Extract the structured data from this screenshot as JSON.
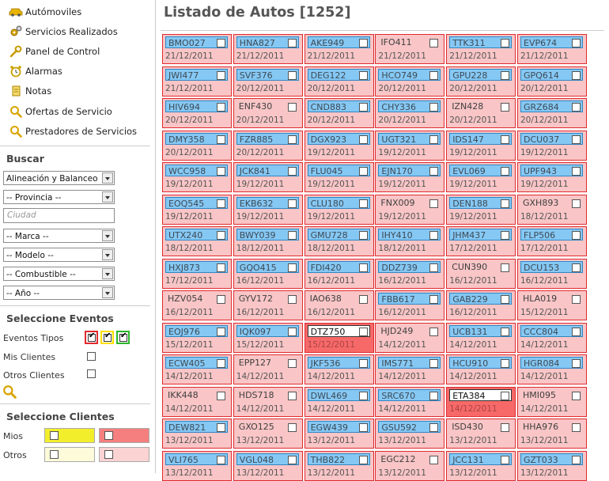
{
  "nav": [
    {
      "label": "Autómoviles",
      "icon": "car-icon"
    },
    {
      "label": "Servicios Realizados",
      "icon": "gears-icon"
    },
    {
      "label": "Panel de Control",
      "icon": "wrench-icon"
    },
    {
      "label": "Alarmas",
      "icon": "alarm-clock-icon"
    },
    {
      "label": "Notas",
      "icon": "note-icon"
    },
    {
      "label": "Ofertas de Servicio",
      "icon": "search-icon"
    },
    {
      "label": "Prestadores de Servicios",
      "icon": "search-icon"
    }
  ],
  "search": {
    "title": "Buscar",
    "servicio": "Alineación y Balanceo",
    "provincia": "-- Provincia --",
    "ciudad_placeholder": "Ciudad",
    "marca": "-- Marca --",
    "modelo": "-- Modelo --",
    "combustible": "-- Combustible --",
    "anio": "-- Año --"
  },
  "events": {
    "title": "Seleccione Eventos",
    "tipos_label": "Eventos Tipos",
    "mis_clientes_label": "Mis Clientes",
    "otros_clientes_label": "Otros Clientes"
  },
  "clients": {
    "title": "Seleccione Clientes",
    "mios_label": "Mios",
    "otros_label": "Otros"
  },
  "colors": {
    "tile_bg": "#f9c5c6",
    "tile_border": "#e02a2e",
    "code_blue": "#86c8f4",
    "highlight": "#f76969",
    "client_yellow": "#f2ee2c",
    "client_red": "#f57f7f"
  },
  "main": {
    "title": "Listado de Autos [1252]"
  },
  "tiles": [
    {
      "code": "BMO027",
      "date": "21/12/2011",
      "style": "blue"
    },
    {
      "code": "HNA827",
      "date": "21/12/2011",
      "style": "blue"
    },
    {
      "code": "AKE949",
      "date": "21/12/2011",
      "style": "blue"
    },
    {
      "code": "IFO411",
      "date": "21/12/2011",
      "style": "plain"
    },
    {
      "code": "TTK311",
      "date": "21/12/2011",
      "style": "blue"
    },
    {
      "code": "EVP674",
      "date": "21/12/2011",
      "style": "blue"
    },
    {
      "code": "JWI477",
      "date": "21/12/2011",
      "style": "blue"
    },
    {
      "code": "SVF376",
      "date": "20/12/2011",
      "style": "blue"
    },
    {
      "code": "DEG122",
      "date": "20/12/2011",
      "style": "blue"
    },
    {
      "code": "HCO749",
      "date": "20/12/2011",
      "style": "blue"
    },
    {
      "code": "GPU228",
      "date": "20/12/2011",
      "style": "blue"
    },
    {
      "code": "GPQ614",
      "date": "20/12/2011",
      "style": "blue"
    },
    {
      "code": "HIV694",
      "date": "20/12/2011",
      "style": "blue"
    },
    {
      "code": "ENF430",
      "date": "20/12/2011",
      "style": "plain"
    },
    {
      "code": "CND883",
      "date": "20/12/2011",
      "style": "blue"
    },
    {
      "code": "CHY336",
      "date": "20/12/2011",
      "style": "blue"
    },
    {
      "code": "IZN428",
      "date": "20/12/2011",
      "style": "plain"
    },
    {
      "code": "GRZ684",
      "date": "20/12/2011",
      "style": "blue"
    },
    {
      "code": "DMY358",
      "date": "20/12/2011",
      "style": "blue"
    },
    {
      "code": "FZR885",
      "date": "20/12/2011",
      "style": "blue"
    },
    {
      "code": "DGX923",
      "date": "19/12/2011",
      "style": "blue"
    },
    {
      "code": "UGT321",
      "date": "19/12/2011",
      "style": "blue"
    },
    {
      "code": "IDS147",
      "date": "19/12/2011",
      "style": "blue"
    },
    {
      "code": "DCU037",
      "date": "19/12/2011",
      "style": "blue"
    },
    {
      "code": "WCC958",
      "date": "19/12/2011",
      "style": "blue"
    },
    {
      "code": "JCK841",
      "date": "19/12/2011",
      "style": "blue"
    },
    {
      "code": "FLU045",
      "date": "19/12/2011",
      "style": "blue"
    },
    {
      "code": "EJN170",
      "date": "19/12/2011",
      "style": "blue"
    },
    {
      "code": "EVL069",
      "date": "19/12/2011",
      "style": "blue"
    },
    {
      "code": "UPF943",
      "date": "19/12/2011",
      "style": "blue"
    },
    {
      "code": "EOQ545",
      "date": "19/12/2011",
      "style": "blue"
    },
    {
      "code": "EKB632",
      "date": "19/12/2011",
      "style": "blue"
    },
    {
      "code": "CLU180",
      "date": "19/12/2011",
      "style": "blue"
    },
    {
      "code": "FNX009",
      "date": "19/12/2011",
      "style": "plain"
    },
    {
      "code": "DEN188",
      "date": "19/12/2011",
      "style": "blue"
    },
    {
      "code": "GXH893",
      "date": "18/12/2011",
      "style": "plain"
    },
    {
      "code": "UTX240",
      "date": "18/12/2011",
      "style": "blue"
    },
    {
      "code": "BWY039",
      "date": "18/12/2011",
      "style": "blue"
    },
    {
      "code": "GMU728",
      "date": "18/12/2011",
      "style": "blue"
    },
    {
      "code": "IHY410",
      "date": "18/12/2011",
      "style": "blue"
    },
    {
      "code": "JHM437",
      "date": "17/12/2011",
      "style": "blue"
    },
    {
      "code": "FLP506",
      "date": "17/12/2011",
      "style": "blue"
    },
    {
      "code": "HXJ873",
      "date": "17/12/2011",
      "style": "blue"
    },
    {
      "code": "GQO415",
      "date": "16/12/2011",
      "style": "blue"
    },
    {
      "code": "FDI420",
      "date": "16/12/2011",
      "style": "blue"
    },
    {
      "code": "DDZ739",
      "date": "16/12/2011",
      "style": "blue"
    },
    {
      "code": "CUN390",
      "date": "16/12/2011",
      "style": "plain"
    },
    {
      "code": "DCU153",
      "date": "16/12/2011",
      "style": "blue"
    },
    {
      "code": "HZV054",
      "date": "16/12/2011",
      "style": "plain"
    },
    {
      "code": "GYV172",
      "date": "16/12/2011",
      "style": "plain"
    },
    {
      "code": "IAO638",
      "date": "16/12/2011",
      "style": "plain"
    },
    {
      "code": "FBB617",
      "date": "16/12/2011",
      "style": "blue"
    },
    {
      "code": "GAB229",
      "date": "16/12/2011",
      "style": "blue"
    },
    {
      "code": "HLA019",
      "date": "15/12/2011",
      "style": "plain"
    },
    {
      "code": "EOJ976",
      "date": "15/12/2011",
      "style": "blue"
    },
    {
      "code": "IQK097",
      "date": "15/12/2011",
      "style": "blue"
    },
    {
      "code": "DTZ750",
      "date": "15/12/2011",
      "style": "highlight"
    },
    {
      "code": "HJD249",
      "date": "14/12/2011",
      "style": "plain"
    },
    {
      "code": "UCB131",
      "date": "14/12/2011",
      "style": "blue"
    },
    {
      "code": "CCC804",
      "date": "14/12/2011",
      "style": "blue"
    },
    {
      "code": "ECW405",
      "date": "14/12/2011",
      "style": "blue"
    },
    {
      "code": "EPP127",
      "date": "14/12/2011",
      "style": "plain"
    },
    {
      "code": "JKF536",
      "date": "14/12/2011",
      "style": "blue"
    },
    {
      "code": "IMS771",
      "date": "14/12/2011",
      "style": "blue"
    },
    {
      "code": "HCU910",
      "date": "14/12/2011",
      "style": "blue"
    },
    {
      "code": "HGR084",
      "date": "14/12/2011",
      "style": "blue"
    },
    {
      "code": "IKK448",
      "date": "14/12/2011",
      "style": "plain"
    },
    {
      "code": "HDS718",
      "date": "14/12/2011",
      "style": "plain"
    },
    {
      "code": "DWL469",
      "date": "14/12/2011",
      "style": "blue"
    },
    {
      "code": "SRC670",
      "date": "14/12/2011",
      "style": "blue"
    },
    {
      "code": "ETA384",
      "date": "14/12/2011",
      "style": "highlight"
    },
    {
      "code": "HMI095",
      "date": "14/12/2011",
      "style": "plain"
    },
    {
      "code": "DEW821",
      "date": "13/12/2011",
      "style": "blue"
    },
    {
      "code": "GXO125",
      "date": "13/12/2011",
      "style": "plain"
    },
    {
      "code": "EGW439",
      "date": "13/12/2011",
      "style": "blue"
    },
    {
      "code": "GSU592",
      "date": "13/12/2011",
      "style": "blue"
    },
    {
      "code": "ISD430",
      "date": "13/12/2011",
      "style": "plain"
    },
    {
      "code": "HHA976",
      "date": "13/12/2011",
      "style": "plain"
    },
    {
      "code": "VLI765",
      "date": "13/12/2011",
      "style": "blue"
    },
    {
      "code": "VGL048",
      "date": "13/12/2011",
      "style": "blue"
    },
    {
      "code": "THB822",
      "date": "13/12/2011",
      "style": "blue"
    },
    {
      "code": "EGC212",
      "date": "13/12/2011",
      "style": "plain"
    },
    {
      "code": "JCC131",
      "date": "13/12/2011",
      "style": "blue"
    },
    {
      "code": "GZT033",
      "date": "13/12/2011",
      "style": "blue"
    }
  ]
}
